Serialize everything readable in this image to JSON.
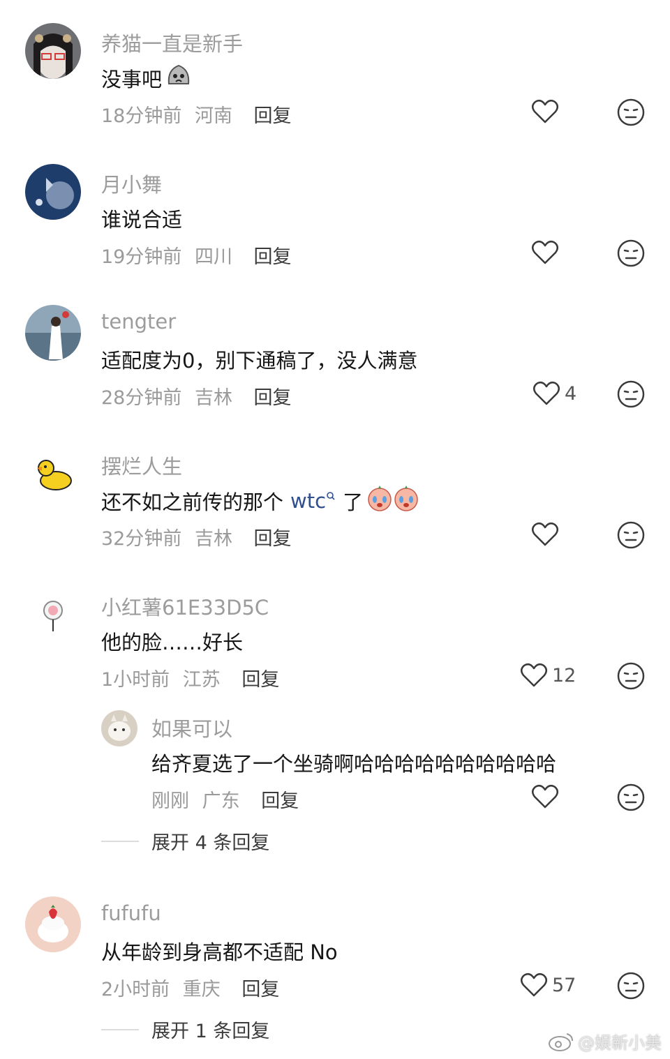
{
  "comments": [
    {
      "name": "养猫一直是新手",
      "text": "没事吧",
      "time": "18分钟前",
      "location": "河南",
      "reply": "回复",
      "likes": ""
    },
    {
      "name": "月小舞",
      "text": "谁说合适",
      "time": "19分钟前",
      "location": "四川",
      "reply": "回复",
      "likes": ""
    },
    {
      "name": "tengter",
      "text": "适配度为0，别下通稿了，没人满意",
      "time": "28分钟前",
      "location": "吉林",
      "reply": "回复",
      "likes": "4"
    },
    {
      "name": "摆烂人生",
      "text_before": "还不如之前传的那个",
      "link": "wtc",
      "text_after": "了",
      "time": "32分钟前",
      "location": "吉林",
      "reply": "回复",
      "likes": ""
    },
    {
      "name": "小红薯61E33D5C",
      "text": "他的脸……好长",
      "time": "1小时前",
      "location": "江苏",
      "reply": "回复",
      "likes": "12",
      "subreply": {
        "name": "如果可以",
        "text": "给齐夏选了一个坐骑啊哈哈哈哈哈哈哈哈哈哈",
        "time": "刚刚",
        "location": "广东",
        "reply": "回复"
      },
      "expand": "展开 4 条回复"
    },
    {
      "name": "fufufu",
      "text": "从年龄到身高都不适配 No",
      "time": "2小时前",
      "location": "重庆",
      "reply": "回复",
      "likes": "57",
      "expand": "展开 1 条回复"
    }
  ],
  "icons": {
    "like": "heart-outline-icon",
    "react": "neutral-face-icon",
    "search": "search-icon"
  },
  "watermark": "@娱新小美"
}
